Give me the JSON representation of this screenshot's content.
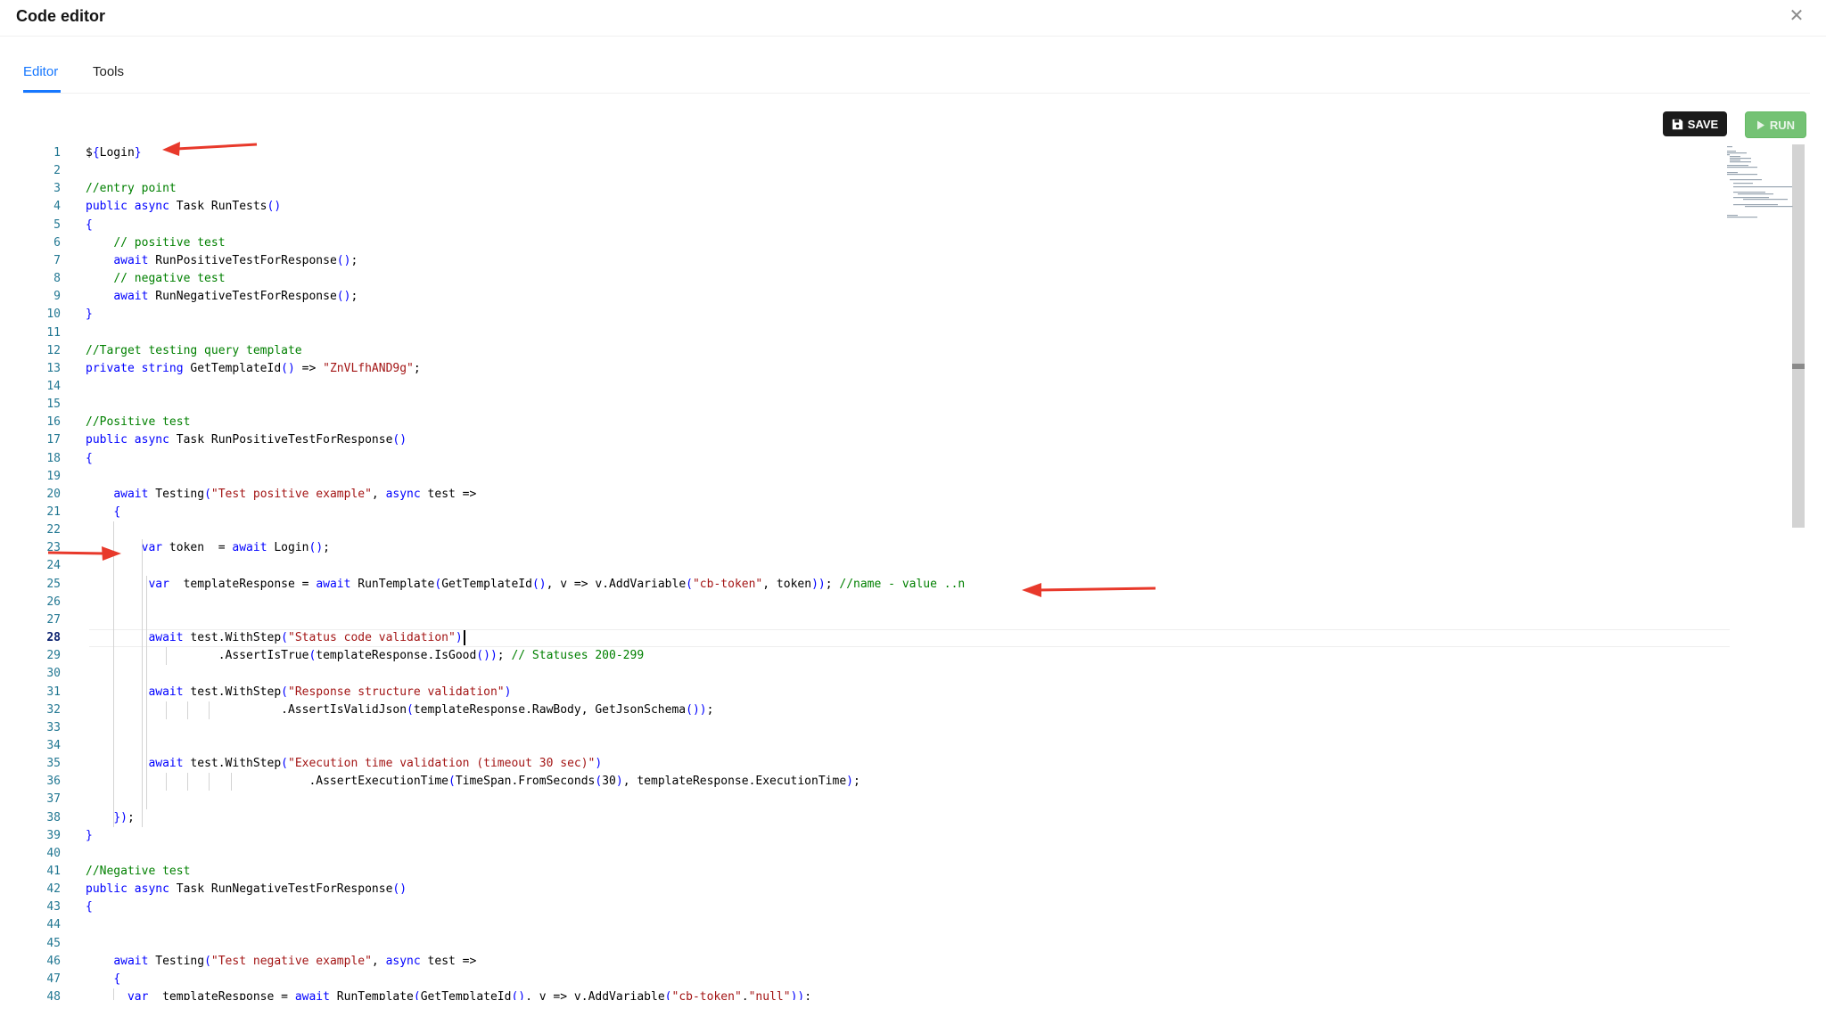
{
  "window": {
    "title": "Code editor"
  },
  "tabs": [
    {
      "label": "Editor",
      "active": true
    },
    {
      "label": "Tools",
      "active": false
    }
  ],
  "toolbar": {
    "save_label": "SAVE",
    "run_label": "RUN"
  },
  "colors": {
    "accent": "#1677ff",
    "save_bg": "#1b1b1b",
    "run_bg": "#5cb85c",
    "annotation_arrow": "#e8392b"
  },
  "editor": {
    "active_line": 28,
    "lines": [
      {
        "n": "1",
        "code": "${Login}"
      },
      {
        "n": "2",
        "code": ""
      },
      {
        "n": "3",
        "code": "//entry point"
      },
      {
        "n": "4",
        "code": "public async Task RunTests()"
      },
      {
        "n": "5",
        "code": "{"
      },
      {
        "n": "6",
        "code": "    // positive test"
      },
      {
        "n": "7",
        "code": "    await RunPositiveTestForResponse();"
      },
      {
        "n": "8",
        "code": "    // negative test"
      },
      {
        "n": "9",
        "code": "    await RunNegativeTestForResponse();"
      },
      {
        "n": "10",
        "code": "}"
      },
      {
        "n": "11",
        "code": ""
      },
      {
        "n": "12",
        "code": "//Target testing query template"
      },
      {
        "n": "13",
        "code": "private string GetTemplateId() => \"ZnVLfhAND9g\";"
      },
      {
        "n": "14",
        "code": ""
      },
      {
        "n": "15",
        "code": ""
      },
      {
        "n": "16",
        "code": "//Positive test"
      },
      {
        "n": "17",
        "code": "public async Task RunPositiveTestForResponse()"
      },
      {
        "n": "18",
        "code": "{"
      },
      {
        "n": "19",
        "code": ""
      },
      {
        "n": "20",
        "code": "    await Testing(\"Test positive example\", async test =>"
      },
      {
        "n": "21",
        "code": "    {"
      },
      {
        "n": "22",
        "code": ""
      },
      {
        "n": "23",
        "code": "        var token  = await Login();"
      },
      {
        "n": "24",
        "code": ""
      },
      {
        "n": "25",
        "code": "         var  templateResponse = await RunTemplate(GetTemplateId(), v => v.AddVariable(\"cb-token\", token)); //name - value ..n"
      },
      {
        "n": "26",
        "code": ""
      },
      {
        "n": "27",
        "code": ""
      },
      {
        "n": "28",
        "code": "         await test.WithStep(\"Status code validation\")"
      },
      {
        "n": "29",
        "code": "                   .AssertIsTrue(templateResponse.IsGood()); // Statuses 200-299"
      },
      {
        "n": "30",
        "code": ""
      },
      {
        "n": "31",
        "code": "         await test.WithStep(\"Response structure validation\")"
      },
      {
        "n": "32",
        "code": "                            .AssertIsValidJson(templateResponse.RawBody, GetJsonSchema());"
      },
      {
        "n": "33",
        "code": ""
      },
      {
        "n": "34",
        "code": ""
      },
      {
        "n": "35",
        "code": "         await test.WithStep(\"Execution time validation (timeout 30 sec)\")"
      },
      {
        "n": "36",
        "code": "                                .AssertExecutionTime(TimeSpan.FromSeconds(30), templateResponse.ExecutionTime);"
      },
      {
        "n": "37",
        "code": ""
      },
      {
        "n": "38",
        "code": "    });"
      },
      {
        "n": "39",
        "code": "}"
      },
      {
        "n": "40",
        "code": ""
      },
      {
        "n": "41",
        "code": "//Negative test"
      },
      {
        "n": "42",
        "code": "public async Task RunNegativeTestForResponse()"
      },
      {
        "n": "43",
        "code": "{"
      },
      {
        "n": "44",
        "code": ""
      },
      {
        "n": "45",
        "code": ""
      },
      {
        "n": "46",
        "code": "    await Testing(\"Test negative example\", async test =>"
      },
      {
        "n": "47",
        "code": "    {"
      },
      {
        "n": "48",
        "code": "      var  templateResponse = await RunTemplate(GetTemplateId(), v => v.AddVariable(\"cb-token\",\"null\"));"
      }
    ]
  }
}
